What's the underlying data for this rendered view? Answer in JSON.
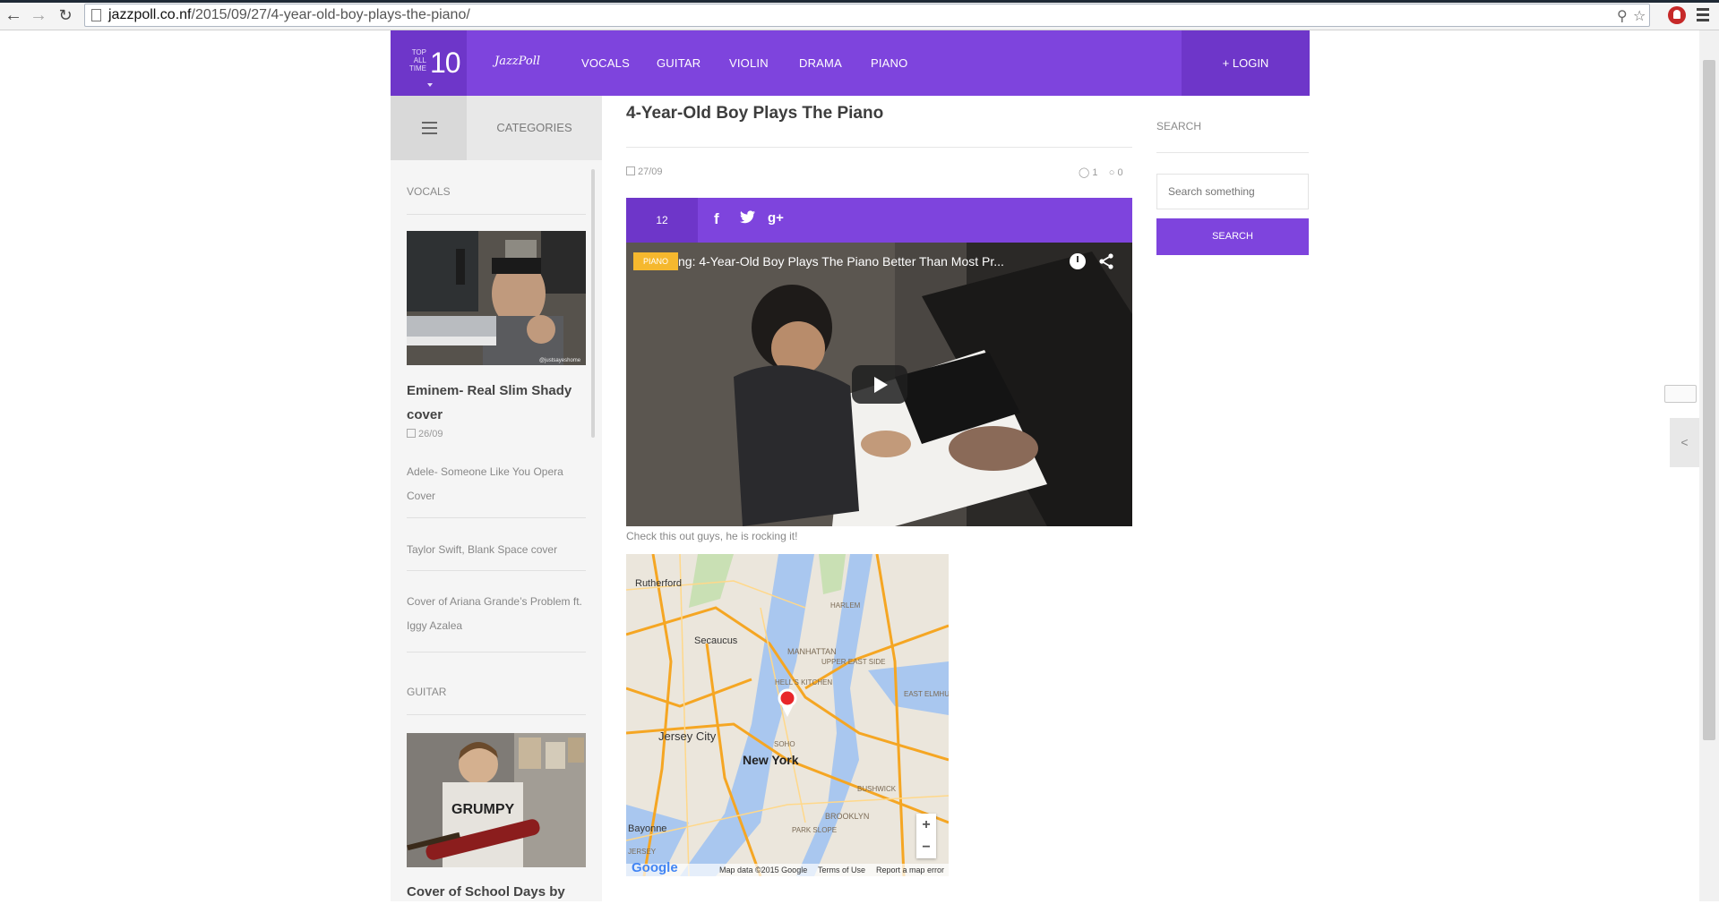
{
  "browser": {
    "url_host": "jazzpoll.co.nf",
    "url_path": "/2015/09/27/4-year-old-boy-plays-the-piano/"
  },
  "header": {
    "brand_small": "TOP ALL TIME",
    "brand_number": "10",
    "logo_text": "JazzPoll",
    "nav": [
      "VOCALS",
      "GUITAR",
      "VIOLIN",
      "DRAMA",
      "PIANO"
    ],
    "login_label": "+ LOGIN",
    "accent": "#7e44dd"
  },
  "sidebar": {
    "categories_tab": "CATEGORIES",
    "sections": [
      {
        "label": "VOCALS",
        "featured_title": "Eminem- Real Slim Shady cover",
        "featured_date": "26/09",
        "items": [
          "Adele- Someone Like You Opera Cover",
          "Taylor Swift, Blank Space cover",
          "Cover of Ariana Grande’s Problem ft. Iggy Azalea"
        ]
      },
      {
        "label": "GUITAR",
        "featured_title": "Cover of School Days by"
      }
    ]
  },
  "post": {
    "title": "4-Year-Old Boy Plays The Piano",
    "date": "27/09",
    "likes": "1",
    "comments": "0",
    "share_count": "12",
    "video_title": "ng: 4-Year-Old Boy Plays The Piano Better Than Most Pr...",
    "video_badge": "PIANO",
    "caption": "Check this out guys, he is rocking it!",
    "map": {
      "labels": [
        "Rutherford",
        "Secaucus",
        "MANHATTAN",
        "UPPER EAST SIDE",
        "HARLEM",
        "HELL'S KITCHEN",
        "Jersey City",
        "New York",
        "SOHO",
        "BROOKLYN",
        "BUSHWICK",
        "PARK SLOPE",
        "EAST ELMHU",
        "Bayonne",
        "JERSEY"
      ],
      "footer_brand": "Google",
      "footer_data": "Map data ©2015 Google",
      "footer_terms": "Terms of Use",
      "footer_report": "Report a map error"
    }
  },
  "search": {
    "label": "SEARCH",
    "placeholder": "Search something",
    "button": "SEARCH"
  }
}
